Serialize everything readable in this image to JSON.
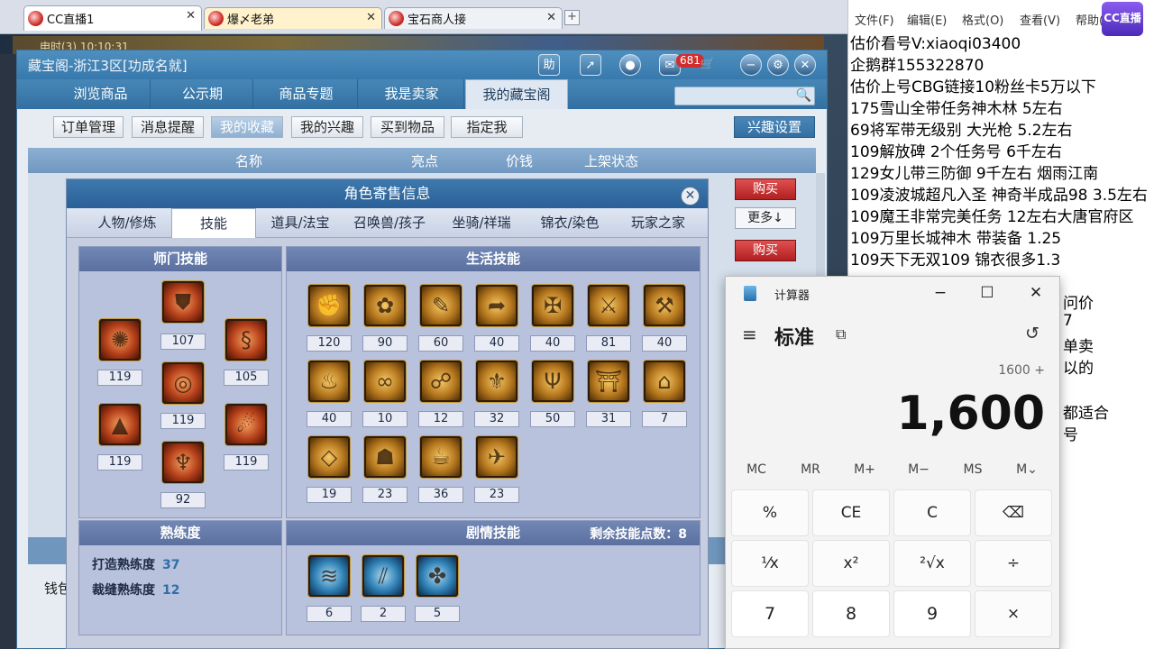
{
  "browser": {
    "tabs": [
      {
        "label": "CC直播1",
        "close": "✕"
      },
      {
        "label": "爆〆老弟",
        "close": "✕"
      },
      {
        "label": "宝石商人接",
        "close": "✕"
      }
    ],
    "new_tab": "+"
  },
  "game": {
    "clock": "申时(3) 10:10:31",
    "arrows": [
      "◀",
      "▲"
    ]
  },
  "window": {
    "title": "藏宝阁-浙江3区[功成名就]",
    "icons": {
      "help": "助",
      "message_badge": "681"
    },
    "nav_tabs": [
      "浏览商品",
      "公示期",
      "商品专题",
      "我是卖家",
      "我的藏宝阁"
    ],
    "sub_buttons": [
      "订单管理",
      "消息提醒",
      "我的收藏",
      "我的兴趣",
      "买到物品",
      "指定我"
    ],
    "interest_settings": "兴趣设置",
    "columns": [
      "名称",
      "亮点",
      "价钱",
      "上架状态"
    ],
    "buy_label": "购买",
    "more_label": "更多↓",
    "wallet_label": "钱包"
  },
  "dialog": {
    "title": "角色寄售信息",
    "close": "✕",
    "tabs": [
      "人物/修炼",
      "技能",
      "道具/法宝",
      "召唤兽/孩子",
      "坐骑/祥瑞",
      "锦衣/染色",
      "玩家之家"
    ],
    "sect_skills": {
      "header": "师门技能",
      "levels": [
        "107",
        "119",
        "105",
        "119",
        "119",
        "119",
        "92"
      ]
    },
    "life_skills": {
      "header": "生活技能",
      "levels": [
        "120",
        "90",
        "60",
        "40",
        "40",
        "81",
        "40",
        "40",
        "10",
        "12",
        "32",
        "50",
        "31",
        "7",
        "19",
        "23",
        "36",
        "23"
      ]
    },
    "proficiency": {
      "header": "熟练度",
      "forging_label": "打造熟练度",
      "forging_value": "37",
      "tailoring_label": "裁缝熟练度",
      "tailoring_value": "12"
    },
    "story_skills": {
      "header": "剧情技能",
      "remain_label": "剩余技能点数：",
      "remain_value": "8",
      "levels": [
        "6",
        "2",
        "5"
      ]
    }
  },
  "notepad": {
    "menu": [
      "文件(F)",
      "编辑(E)",
      "格式(O)",
      "查看(V)",
      "帮助(H)"
    ],
    "lines": [
      "估价看号V:xiaoqi03400",
      "企鹅群155322870",
      "估价上号CBG链接10粉丝卡5万以下",
      "175雪山全带任务神木林 5左右",
      "69将军带无级别 大光枪 5.2左右",
      "109解放碑 2个任务号 6千左右",
      "129女儿带三防御 9千左右 烟雨江南",
      "109凌波城超凡入圣 神奇半成品98 3.5左右",
      "109魔王非常完美任务 12左右大唐官府区",
      "109万里长城神木 带装备  1.25",
      "109天下无双109  锦衣很多1.3"
    ],
    "partial": [
      "问价",
      "7",
      "单卖",
      "以的",
      "都适合",
      "号"
    ],
    "logo": "CC直播"
  },
  "calculator": {
    "title": "计算器",
    "mode": "标准",
    "expression": "1600 +",
    "display": "1,600",
    "memory": [
      "MC",
      "MR",
      "M+",
      "M−",
      "MS",
      "M⌄"
    ],
    "keys": [
      "%",
      "CE",
      "C",
      "⌫",
      "¹⁄x",
      "x²",
      "²√x",
      "÷",
      "7",
      "8",
      "9",
      "×"
    ]
  }
}
